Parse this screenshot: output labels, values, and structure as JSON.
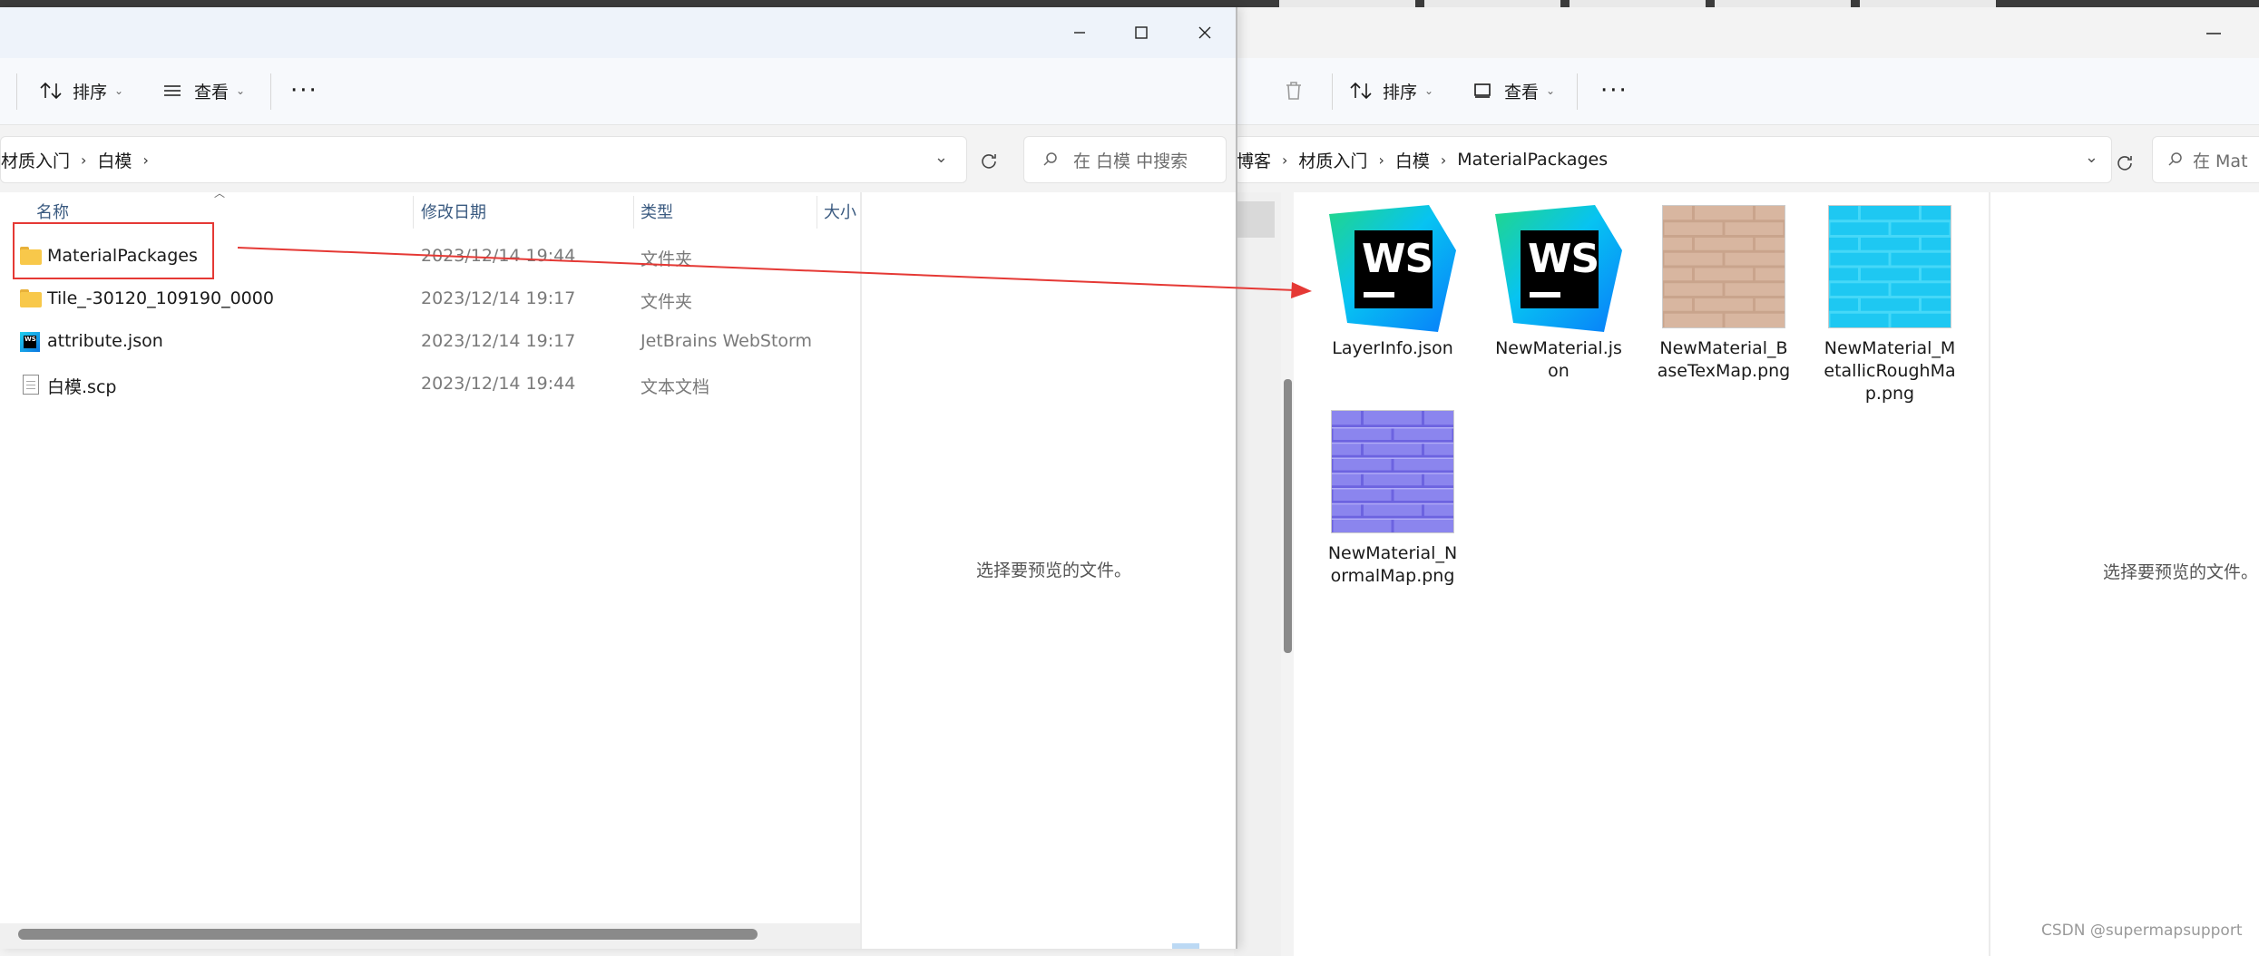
{
  "right_window": {
    "toolbar": {
      "sort_label": "排序",
      "view_label": "查看"
    },
    "breadcrumbs": [
      "博客",
      "材质入门",
      "白模",
      "MaterialPackages"
    ],
    "search_placeholder": "在 Mat",
    "preview_message": "选择要预览的文件。",
    "files": [
      {
        "label": "LayerInfo.json",
        "kind": "webstorm-icon"
      },
      {
        "label": "NewMaterial.json",
        "kind": "webstorm-icon"
      },
      {
        "label": "NewMaterial_BaseTexMap.png",
        "kind": "brick-texture"
      },
      {
        "label": "NewMaterial_MetallicRoughMap.png",
        "kind": "cyan-brick-texture"
      },
      {
        "label": "NewMaterial_NormalMap.png",
        "kind": "normal-map-texture"
      }
    ]
  },
  "left_window": {
    "toolbar": {
      "sort_label": "排序",
      "view_label": "查看"
    },
    "breadcrumbs": [
      "材质入门",
      "白模"
    ],
    "search_placeholder": "在 白模 中搜索",
    "columns": {
      "name": "名称",
      "modified": "修改日期",
      "type": "类型",
      "size": "大小"
    },
    "rows": [
      {
        "name": "MaterialPackages",
        "modified": "2023/12/14 19:44",
        "type": "文件夹",
        "icon": "folder-icon"
      },
      {
        "name": "Tile_-30120_109190_0000",
        "modified": "2023/12/14 19:17",
        "type": "文件夹",
        "icon": "folder-icon"
      },
      {
        "name": "attribute.json",
        "modified": "2023/12/14 19:17",
        "type": "JetBrains WebStorm",
        "icon": "webstorm-icon"
      },
      {
        "name": "白模.scp",
        "modified": "2023/12/14 19:44",
        "type": "文本文档",
        "icon": "document-icon"
      }
    ],
    "preview_message": "选择要预览的文件。"
  },
  "watermark": "CSDN @supermapsupport",
  "colors": {
    "annotation_red": "#e53935",
    "column_header": "#3a5a80"
  }
}
